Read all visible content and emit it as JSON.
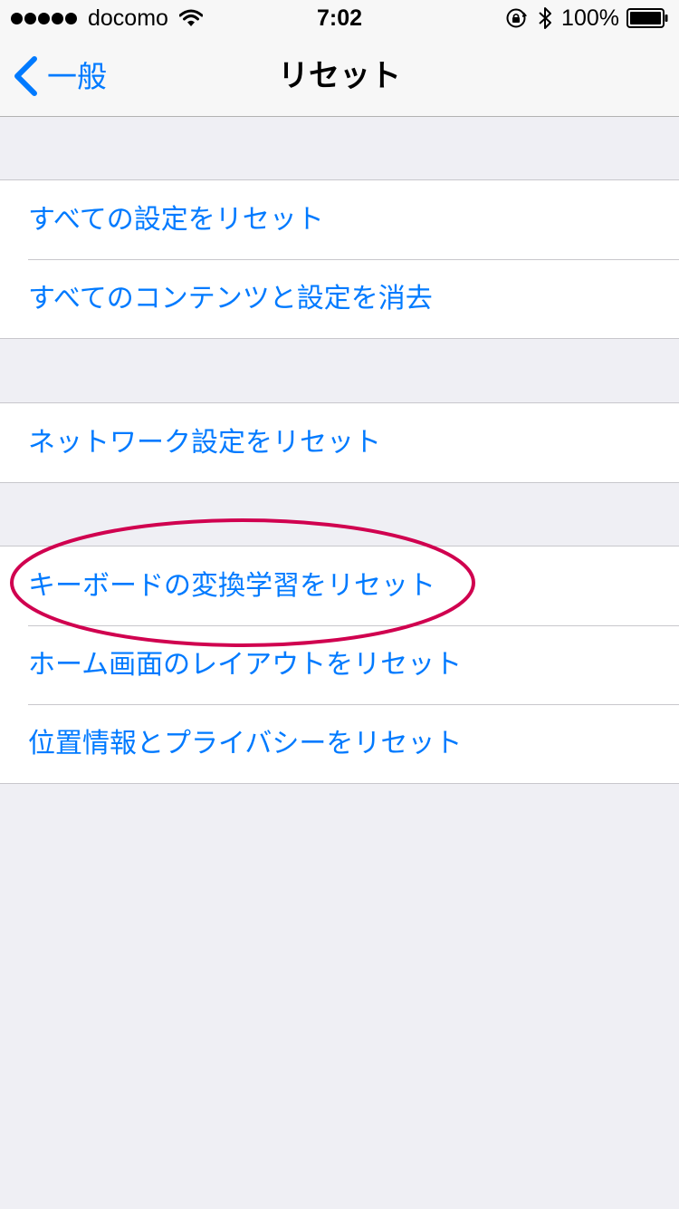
{
  "status_bar": {
    "carrier": "docomo",
    "time": "7:02",
    "battery": "100%",
    "signal_bars": 5,
    "icons": [
      "signal-dots",
      "wifi-icon",
      "rotation-lock-icon",
      "bluetooth-icon",
      "battery-icon"
    ]
  },
  "nav": {
    "back_label": "一般",
    "title": "リセット",
    "back_icon": "chevron-left-icon"
  },
  "groups": [
    {
      "items": [
        "すべての設定をリセット",
        "すべてのコンテンツと設定を消去"
      ]
    },
    {
      "items": [
        "ネットワーク設定をリセット"
      ]
    },
    {
      "items": [
        "キーボードの変換学習をリセット",
        "ホーム画面のレイアウトをリセット",
        "位置情報とプライバシーをリセット"
      ]
    }
  ],
  "colors": {
    "accent": "#007aff",
    "background": "#efeff4",
    "separator": "#c8c7cc",
    "annotation": "#d0004f"
  }
}
